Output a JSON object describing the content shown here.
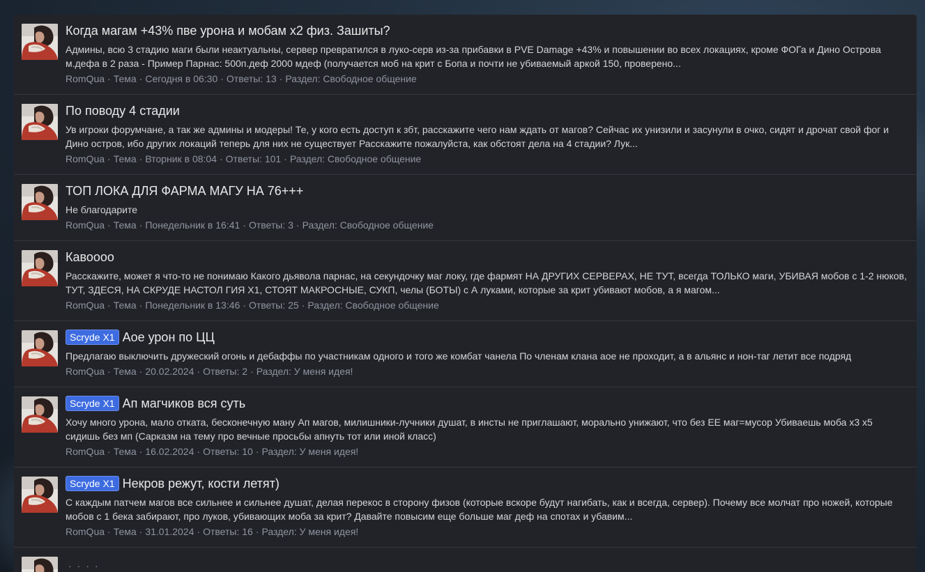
{
  "results": [
    {
      "prefix": "",
      "title": "Когда магам +43% пве урона и мобам х2 физ. Зашиты?",
      "snippet": "Админы, всю 3 стадию маги были неактуальны, сервер превратился в луко-серв из-за прибавки в PVE Damage +43% и повышении во всех локациях, кроме ФОГа и Дино Острова м.дефа в 2 раза - Пример Парнас: 500п.деф 2000 мдеф (получается моб на крит с Бопа и почти не убиваемый аркой 150, проверено...",
      "author": "RomQua",
      "type": "Тема",
      "date": "Сегодня в 06:30",
      "replies": "Ответы: 13",
      "forum": "Раздел: Свободное общение"
    },
    {
      "prefix": "",
      "title": "По поводу 4 стадии",
      "snippet": "Ув игроки форумчане, а так же админы и модеры! Те, у кого есть доступ к збт, расскажите чего нам ждать от магов? Сейчас их унизили и засунули в очко, сидят и дрочат свой фог и Дино остров, ибо других локаций теперь для них не существует Расскажите пожалуйста, как обстоят дела на 4 стадии? Лук...",
      "author": "RomQua",
      "type": "Тема",
      "date": "Вторник в 08:04",
      "replies": "Ответы: 101",
      "forum": "Раздел: Свободное общение"
    },
    {
      "prefix": "",
      "title": "ТОП ЛОКА ДЛЯ ФАРМА МАГУ НА 76+++",
      "snippet": "Не благодарите",
      "author": "RomQua",
      "type": "Тема",
      "date": "Понедельник в 16:41",
      "replies": "Ответы: 3",
      "forum": "Раздел: Свободное общение"
    },
    {
      "prefix": "",
      "title": "Кавоооо",
      "snippet": "Расскажите, может я что-то не понимаю Какого дьявола парнас, на секундочку маг локу, где фармят НА ДРУГИХ СЕРВЕРАХ, НЕ ТУТ, всегда ТОЛЬКО маги, УБИВАЯ мобов с 1-2 нюков, ТУТ, ЗДЕСЯ, НА СКРУДЕ НАСТОЛ ГИЯ X1, СТОЯТ МАКРОСНЫЕ, СУКП, челы (БОТЫ) с А луками, которые за крит убивают мобов, а я магом...",
      "author": "RomQua",
      "type": "Тема",
      "date": "Понедельник в 13:46",
      "replies": "Ответы: 25",
      "forum": "Раздел: Свободное общение"
    },
    {
      "prefix": "Scryde X1",
      "title": "Аое урон по ЦЦ",
      "snippet": "Предлагаю выключить дружеский огонь и дебаффы по участникам одного и того же комбат чанела По членам клана аое не проходит, а в альянс и нон-таг летит все подряд",
      "author": "RomQua",
      "type": "Тема",
      "date": "20.02.2024",
      "replies": "Ответы: 2",
      "forum": "Раздел: У меня идея!"
    },
    {
      "prefix": "Scryde X1",
      "title": "Ап магчиков вся суть",
      "snippet": "Хочу много урона, мало отката, бесконечную ману Ап магов, милишники-лучники душат, в инсты не приглашают, морально унижают, что без ЕЕ маг=мусор Убиваешь моба х3 х5 сидишь без мп (Сарказм на тему про вечные просьбы апнуть тот или иной класс)",
      "author": "RomQua",
      "type": "Тема",
      "date": "16.02.2024",
      "replies": "Ответы: 10",
      "forum": "Раздел: У меня идея!"
    },
    {
      "prefix": "Scryde X1",
      "title": "Некров режут, кости летят)",
      "snippet": "С каждым патчем магов все сильнее и сильнее душат, делая перекос в сторону физов (которые вскоре будут нагибать, как и всегда, сервер). Почему все молчат про ножей, которые мобов с 1 бека забирают, про луков, убивающих моба за крит? Давайте повысим еще больше маг деф на спотах и убавим...",
      "author": "RomQua",
      "type": "Тема",
      "date": "31.01.2024",
      "replies": "Ответы: 16",
      "forum": "Раздел: У меня идея!"
    },
    {
      "prefix": "",
      "title": "",
      "snippet": "",
      "author": "",
      "type": "",
      "date": "",
      "replies": "",
      "forum": ""
    }
  ]
}
